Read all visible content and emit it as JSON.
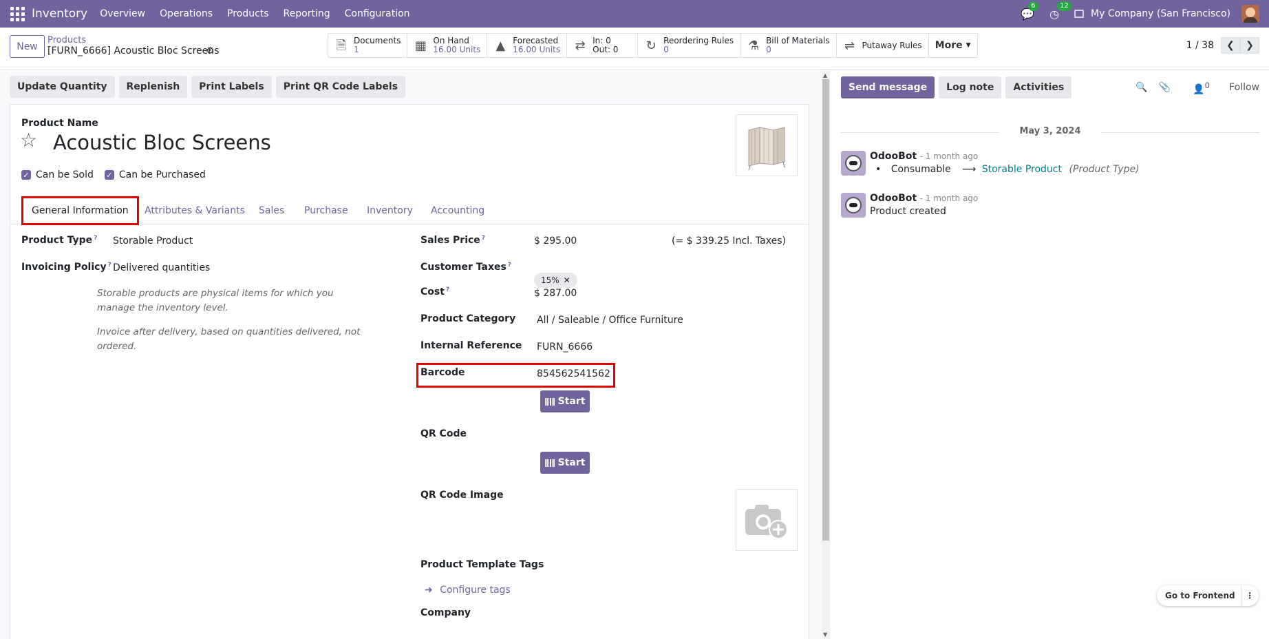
{
  "navbar": {
    "app_name": "Inventory",
    "menu": [
      "Overview",
      "Operations",
      "Products",
      "Reporting",
      "Configuration"
    ],
    "messages_count": "6",
    "activities_count": "12",
    "company": "My Company (San Francisco)"
  },
  "breadcrumb": {
    "new_label": "New",
    "parent": "Products",
    "current": "[FURN_6666] Acoustic Bloc Screens"
  },
  "smart_buttons": [
    {
      "icon": "file-icon",
      "label": "Documents",
      "value": "1"
    },
    {
      "icon": "cubes-icon",
      "label": "On Hand",
      "value": "16.00 Units"
    },
    {
      "icon": "area-chart-icon",
      "label": "Forecasted",
      "value": "16.00 Units"
    },
    {
      "icon": "exchange-icon",
      "label": "In: 0",
      "value": "Out: 0"
    },
    {
      "icon": "refresh-icon",
      "label": "Reordering Rules",
      "value": "0"
    },
    {
      "icon": "flask-icon",
      "label": "Bill of Materials",
      "value": "0"
    },
    {
      "icon": "random-icon",
      "label": "Putaway Rules",
      "value": ""
    }
  ],
  "more_label": "More",
  "pager": {
    "value": "1 / 38"
  },
  "status_buttons": [
    "Update Quantity",
    "Replenish",
    "Print Labels",
    "Print QR Code Labels"
  ],
  "form": {
    "product_name_label": "Product Name",
    "product_name": "Acoustic Bloc Screens",
    "can_be_sold": "Can be Sold",
    "can_be_purchased": "Can be Purchased",
    "tabs": [
      "General Information",
      "Attributes & Variants",
      "Sales",
      "Purchase",
      "Inventory",
      "Accounting"
    ],
    "product_type_label": "Product Type",
    "product_type": "Storable Product",
    "invoicing_policy_label": "Invoicing Policy",
    "invoicing_policy": "Delivered quantities",
    "hint_type": "Storable products are physical items for which you manage the inventory level.",
    "hint_invoice": "Invoice after delivery, based on quantities delivered, not ordered.",
    "sales_price_label": "Sales Price",
    "sales_price": "$ 295.00",
    "incl_taxes": "(= $ 339.25 Incl. Taxes)",
    "customer_taxes_label": "Customer Taxes",
    "customer_tax": "15%",
    "cost_label": "Cost",
    "cost": "$ 287.00",
    "category_label": "Product Category",
    "category": "All / Saleable / Office Furniture",
    "internal_ref_label": "Internal Reference",
    "internal_ref": "FURN_6666",
    "barcode_label": "Barcode",
    "barcode": "854562541562",
    "start_label": "Start",
    "qr_code_label": "QR Code",
    "qr_image_label": "QR Code Image",
    "template_tags_label": "Product Template Tags",
    "configure_tags": "Configure tags",
    "company_label": "Company"
  },
  "chatter": {
    "send_message": "Send message",
    "log_note": "Log note",
    "activities": "Activities",
    "followers_count": "0",
    "follow": "Follow",
    "date": "May 3, 2024",
    "messages": [
      {
        "author": "OdooBot",
        "time": "- 1 month ago",
        "old_value": "Consumable",
        "new_value": "Storable Product",
        "field": "(Product Type)"
      },
      {
        "author": "OdooBot",
        "time": "- 1 month ago",
        "body": "Product created"
      }
    ]
  },
  "go_frontend": "Go to Frontend",
  "colors": {
    "brand": "#71639e",
    "highlight": "#e00000",
    "success_badge": "#28a745",
    "link_teal": "#017e84"
  }
}
